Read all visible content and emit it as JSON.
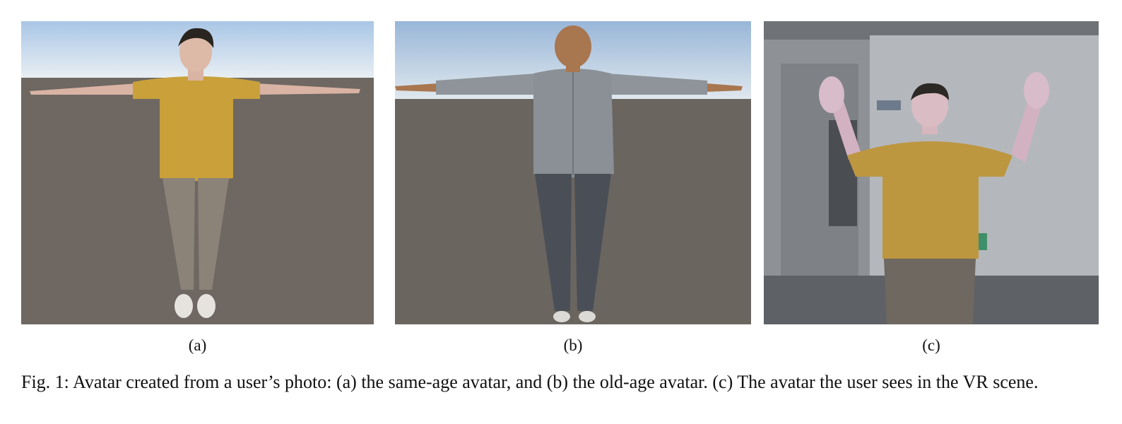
{
  "figure": {
    "panels": [
      {
        "id": "a",
        "label": "(a)",
        "subject": "same-age avatar in T-pose, yellow t-shirt, khaki pants"
      },
      {
        "id": "b",
        "label": "(b)",
        "subject": "old-age avatar in T-pose, grey striped shirt, dark jeans"
      },
      {
        "id": "c",
        "label": "(c)",
        "subject": "avatar seen by user in VR scene, hands raised"
      }
    ],
    "caption": "Fig. 1: Avatar created from a user’s photo: (a) the same-age avatar, and (b) the old-age avatar. (c) The avatar the user sees in the VR scene."
  },
  "colors": {
    "sky_top": "#a9c6e6",
    "ground": "#6e6762",
    "shirt_yellow": "#c9a03a",
    "shirt_grey": "#8e9499",
    "skin": "#d9b3a4",
    "skin_dark": "#a8764f",
    "pants_khaki": "#8c8378",
    "jeans": "#4a4f57",
    "room_wall": "#a9adb2"
  }
}
